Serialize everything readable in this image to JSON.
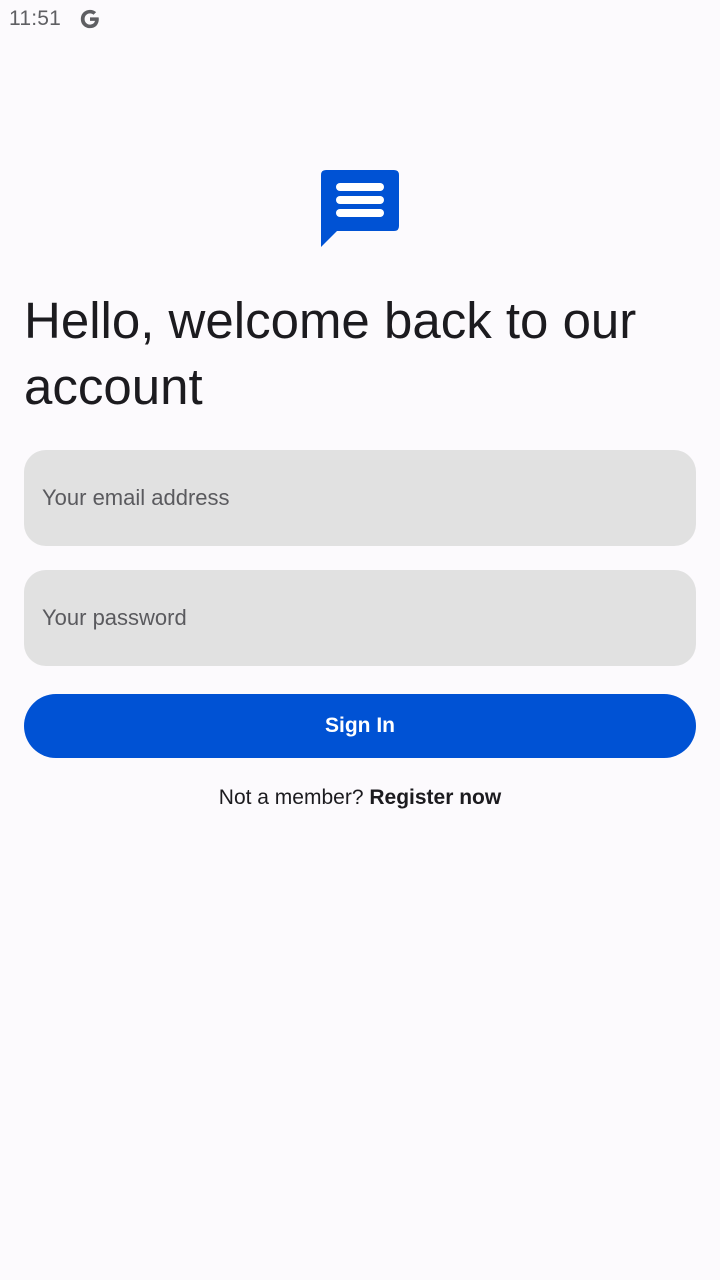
{
  "status_bar": {
    "time": "11:51",
    "notification_icon": "google-g-icon"
  },
  "logo": {
    "icon": "chat-bubble-icon",
    "color": "#0052d4"
  },
  "headline": "Hello, welcome back to our account",
  "form": {
    "email": {
      "placeholder": "Your email address",
      "value": ""
    },
    "password": {
      "placeholder": "Your password",
      "value": ""
    },
    "signin_label": "Sign In"
  },
  "register": {
    "prompt": "Not a member?",
    "link_label": "Register now"
  },
  "colors": {
    "accent": "#0052d4",
    "field_bg": "#e1e1e1",
    "background": "#fcfafd"
  }
}
